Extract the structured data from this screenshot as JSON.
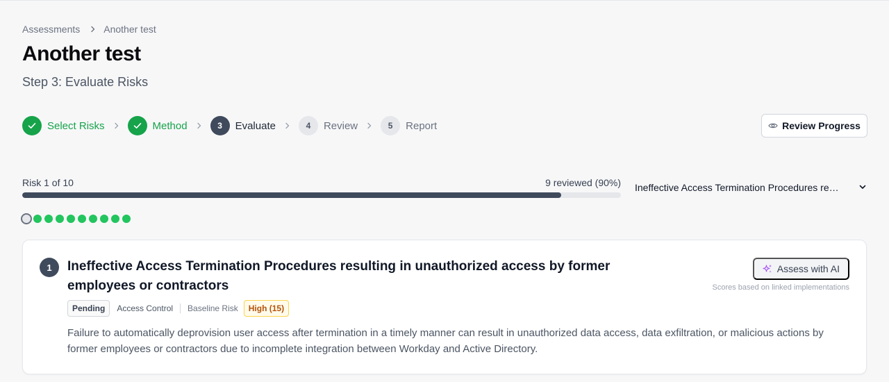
{
  "breadcrumb": {
    "parent": "Assessments",
    "current": "Another test"
  },
  "page": {
    "title": "Another test",
    "subtitle": "Step 3: Evaluate Risks"
  },
  "stepper": {
    "steps": [
      {
        "number": "1",
        "label": "Select Risks",
        "state": "done"
      },
      {
        "number": "2",
        "label": "Method",
        "state": "done"
      },
      {
        "number": "3",
        "label": "Evaluate",
        "state": "current"
      },
      {
        "number": "4",
        "label": "Review",
        "state": "todo"
      },
      {
        "number": "5",
        "label": "Report",
        "state": "todo"
      }
    ]
  },
  "review_button": {
    "label": "Review Progress",
    "icon": "eye-icon"
  },
  "progress": {
    "label": "Risk 1 of 10",
    "count": "9 reviewed (90%)",
    "fraction": 0.9,
    "dots": [
      "current",
      "done",
      "done",
      "done",
      "done",
      "done",
      "done",
      "done",
      "done",
      "done"
    ]
  },
  "risk_select": {
    "value": "Ineffective Access Termination Procedures resulting in unauthorized access by former employees or contractors"
  },
  "risk": {
    "number": "1",
    "title": "Ineffective Access Termination Procedures resulting in unauthorized access by former employees or contractors",
    "status": "Pending",
    "category": "Access Control",
    "baseline_label": "Baseline Risk",
    "baseline_value": "High (15)",
    "description": "Failure to automatically deprovision user access after termination in a timely manner can result in unauthorized data access, data exfiltration, or malicious actions by former employees or contractors due to incomplete integration between Workday and Active Directory."
  },
  "ai": {
    "label": "Assess with AI",
    "note": "Scores based on linked implementations",
    "icon": "sparkles-icon"
  },
  "colors": {
    "done": "#16a34a",
    "current": "#3f4a5c",
    "dot_done": "#22c55e",
    "high_badge": "#b45309"
  }
}
